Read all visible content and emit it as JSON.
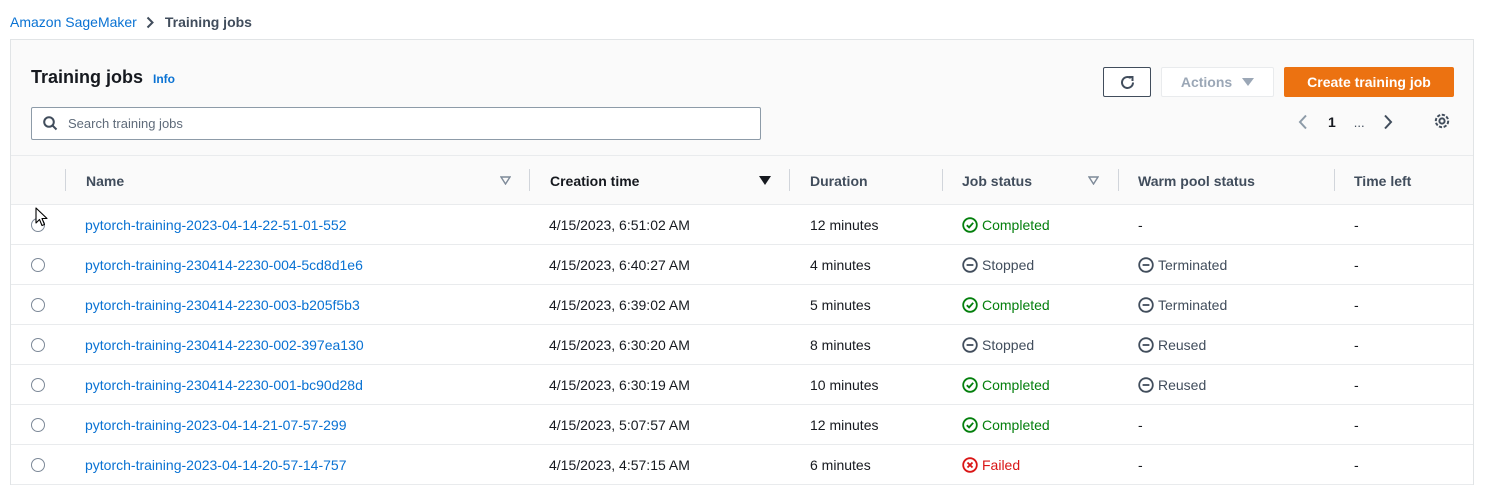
{
  "breadcrumb": {
    "items": [
      {
        "label": "Amazon SageMaker"
      },
      {
        "label": "Training jobs"
      }
    ]
  },
  "header": {
    "title": "Training jobs",
    "info_label": "Info",
    "actions_label": "Actions",
    "create_label": "Create training job"
  },
  "search": {
    "placeholder": "Search training jobs"
  },
  "pagination": {
    "current_page": "1",
    "ellipsis": "..."
  },
  "table": {
    "columns": {
      "name": "Name",
      "creation_time": "Creation time",
      "duration": "Duration",
      "job_status": "Job status",
      "warm_pool_status": "Warm pool status",
      "time_left": "Time left"
    },
    "rows": [
      {
        "name": "pytorch-training-2023-04-14-22-51-01-552",
        "creation_time": "4/15/2023, 6:51:02 AM",
        "duration": "12 minutes",
        "job_status": "Completed",
        "warm_pool_status": "-",
        "time_left": "-"
      },
      {
        "name": "pytorch-training-230414-2230-004-5cd8d1e6",
        "creation_time": "4/15/2023, 6:40:27 AM",
        "duration": "4 minutes",
        "job_status": "Stopped",
        "warm_pool_status": "Terminated",
        "time_left": "-"
      },
      {
        "name": "pytorch-training-230414-2230-003-b205f5b3",
        "creation_time": "4/15/2023, 6:39:02 AM",
        "duration": "5 minutes",
        "job_status": "Completed",
        "warm_pool_status": "Terminated",
        "time_left": "-"
      },
      {
        "name": "pytorch-training-230414-2230-002-397ea130",
        "creation_time": "4/15/2023, 6:30:20 AM",
        "duration": "8 minutes",
        "job_status": "Stopped",
        "warm_pool_status": "Reused",
        "time_left": "-"
      },
      {
        "name": "pytorch-training-230414-2230-001-bc90d28d",
        "creation_time": "4/15/2023, 6:30:19 AM",
        "duration": "10 minutes",
        "job_status": "Completed",
        "warm_pool_status": "Reused",
        "time_left": "-"
      },
      {
        "name": "pytorch-training-2023-04-14-21-07-57-299",
        "creation_time": "4/15/2023, 5:07:57 AM",
        "duration": "12 minutes",
        "job_status": "Completed",
        "warm_pool_status": "-",
        "time_left": "-"
      },
      {
        "name": "pytorch-training-2023-04-14-20-57-14-757",
        "creation_time": "4/15/2023, 4:57:15 AM",
        "duration": "6 minutes",
        "job_status": "Failed",
        "warm_pool_status": "-",
        "time_left": "-"
      }
    ]
  },
  "colors": {
    "link": "#0972d3",
    "primary_button": "#ec7211",
    "status_success": "#037f0c",
    "status_stopped": "#414d5c",
    "status_error": "#d91515"
  },
  "icons": {
    "breadcrumb_separator": "chevron-right-icon",
    "refresh": "refresh-icon",
    "actions_caret": "caret-down-icon",
    "search": "search-icon",
    "prev_page": "chevron-left-icon",
    "next_page": "chevron-right-icon",
    "preferences": "gear-icon",
    "completed": "check-circle-icon",
    "stopped": "minus-circle-icon",
    "failed": "x-circle-icon"
  }
}
